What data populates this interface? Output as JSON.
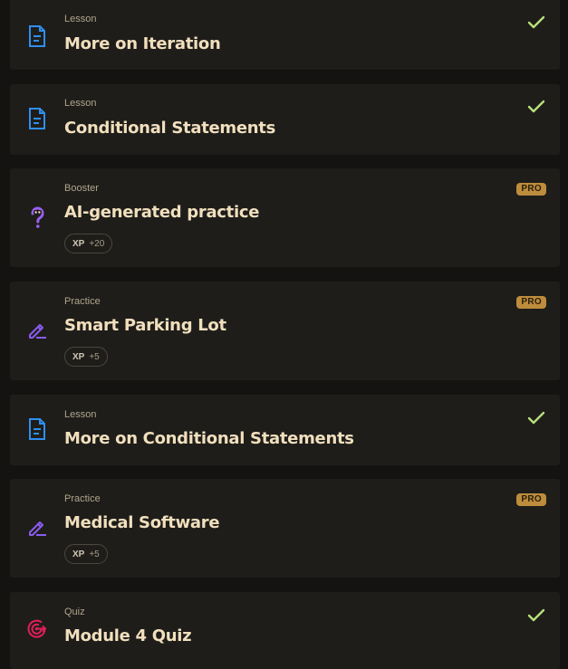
{
  "colors": {
    "lesson_icon": "#2f8ff0",
    "practice_icon": "#8a5cf0",
    "booster_icon": "#9a5ff5",
    "quiz_icon": "#e01e5a",
    "check": "#b7e07a",
    "pro_badge": "#bd8c3c"
  },
  "items": [
    {
      "type": "Lesson",
      "title": "More on Iteration",
      "icon": "document-icon",
      "completed": true
    },
    {
      "type": "Lesson",
      "title": "Conditional Statements",
      "icon": "document-icon",
      "completed": true
    },
    {
      "type": "Booster",
      "title": "AI-generated practice",
      "icon": "question-bot-icon",
      "pro": "PRO",
      "xp_label": "XP",
      "xp_value": "+20"
    },
    {
      "type": "Practice",
      "title": "Smart Parking Lot",
      "icon": "pencil-edit-icon",
      "pro": "PRO",
      "xp_label": "XP",
      "xp_value": "+5"
    },
    {
      "type": "Lesson",
      "title": "More on Conditional Statements",
      "icon": "document-icon",
      "completed": true
    },
    {
      "type": "Practice",
      "title": "Medical Software",
      "icon": "pencil-edit-icon",
      "pro": "PRO",
      "xp_label": "XP",
      "xp_value": "+5"
    },
    {
      "type": "Quiz",
      "title": "Module 4 Quiz",
      "icon": "target-icon",
      "completed": true
    }
  ]
}
